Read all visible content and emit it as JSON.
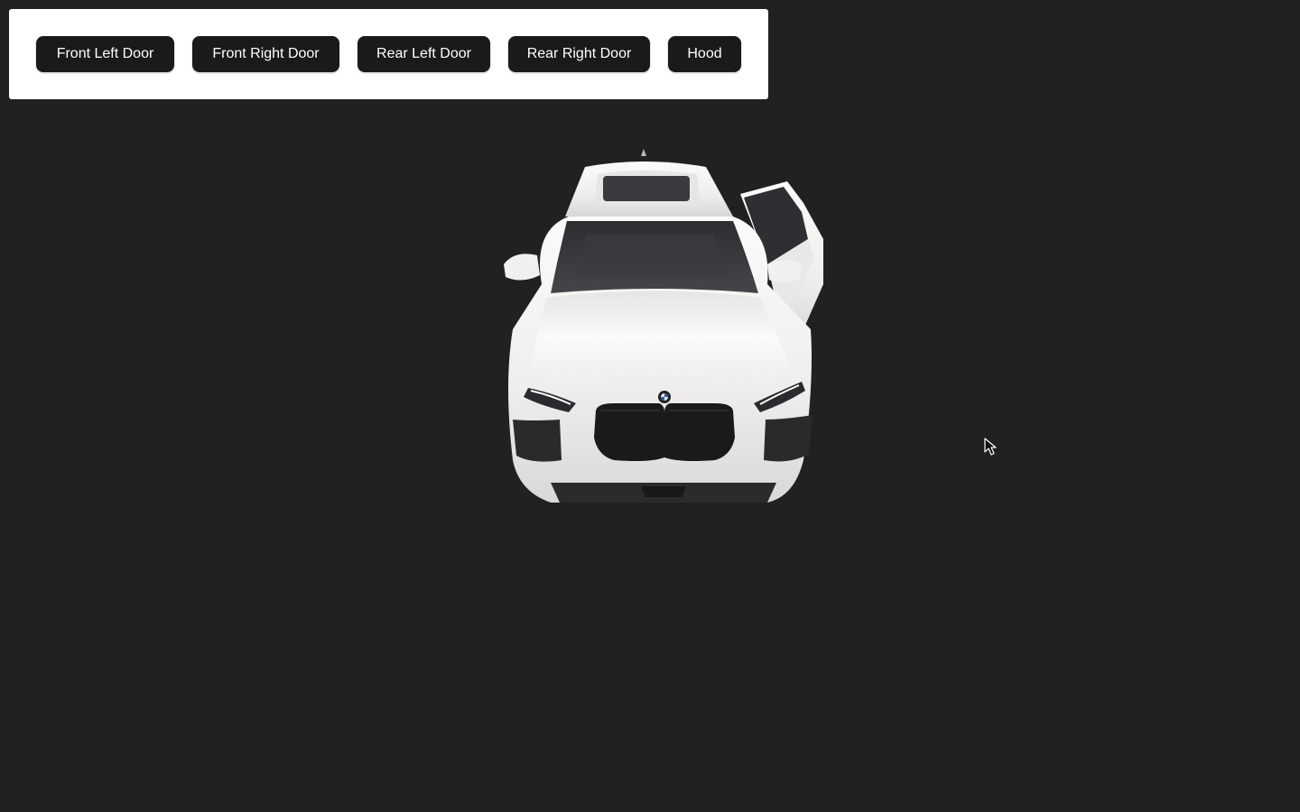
{
  "toolbar": {
    "buttons": [
      {
        "id": "front-left-door",
        "label": "Front Left Door"
      },
      {
        "id": "front-right-door",
        "label": "Front Right Door"
      },
      {
        "id": "rear-left-door",
        "label": "Rear Left Door"
      },
      {
        "id": "rear-right-door",
        "label": "Rear Right Door"
      },
      {
        "id": "hood",
        "label": "Hood"
      }
    ]
  },
  "scene": {
    "background_color": "#212121",
    "car_color": "#f3f2f0",
    "open_part": "front-right-door"
  },
  "icons": {
    "cursor": "arrow-pointer-icon",
    "logo": "bmw-roundel-icon"
  }
}
